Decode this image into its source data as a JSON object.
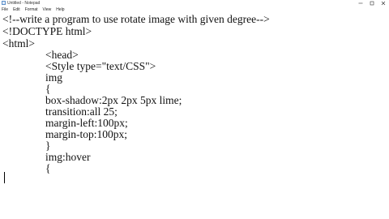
{
  "window": {
    "title": "Untitled - Notepad",
    "controls": [
      "minimize-icon",
      "maximize-icon",
      "close-icon"
    ]
  },
  "menu": [
    "File",
    "Edit",
    "Format",
    "View",
    "Help"
  ],
  "editor": {
    "lines": [
      "<!--write a program to use rotate image with given degree-->",
      "<!DOCTYPE html>",
      "<html>",
      "<head>",
      "<Style type=\"text/CSS\">",
      "img",
      "{",
      "box-shadow:2px 2px 5px lime;",
      "transition:all 25;",
      "margin-left:100px;",
      "margin-top:100px;",
      "}",
      "img:hover",
      "{"
    ]
  }
}
